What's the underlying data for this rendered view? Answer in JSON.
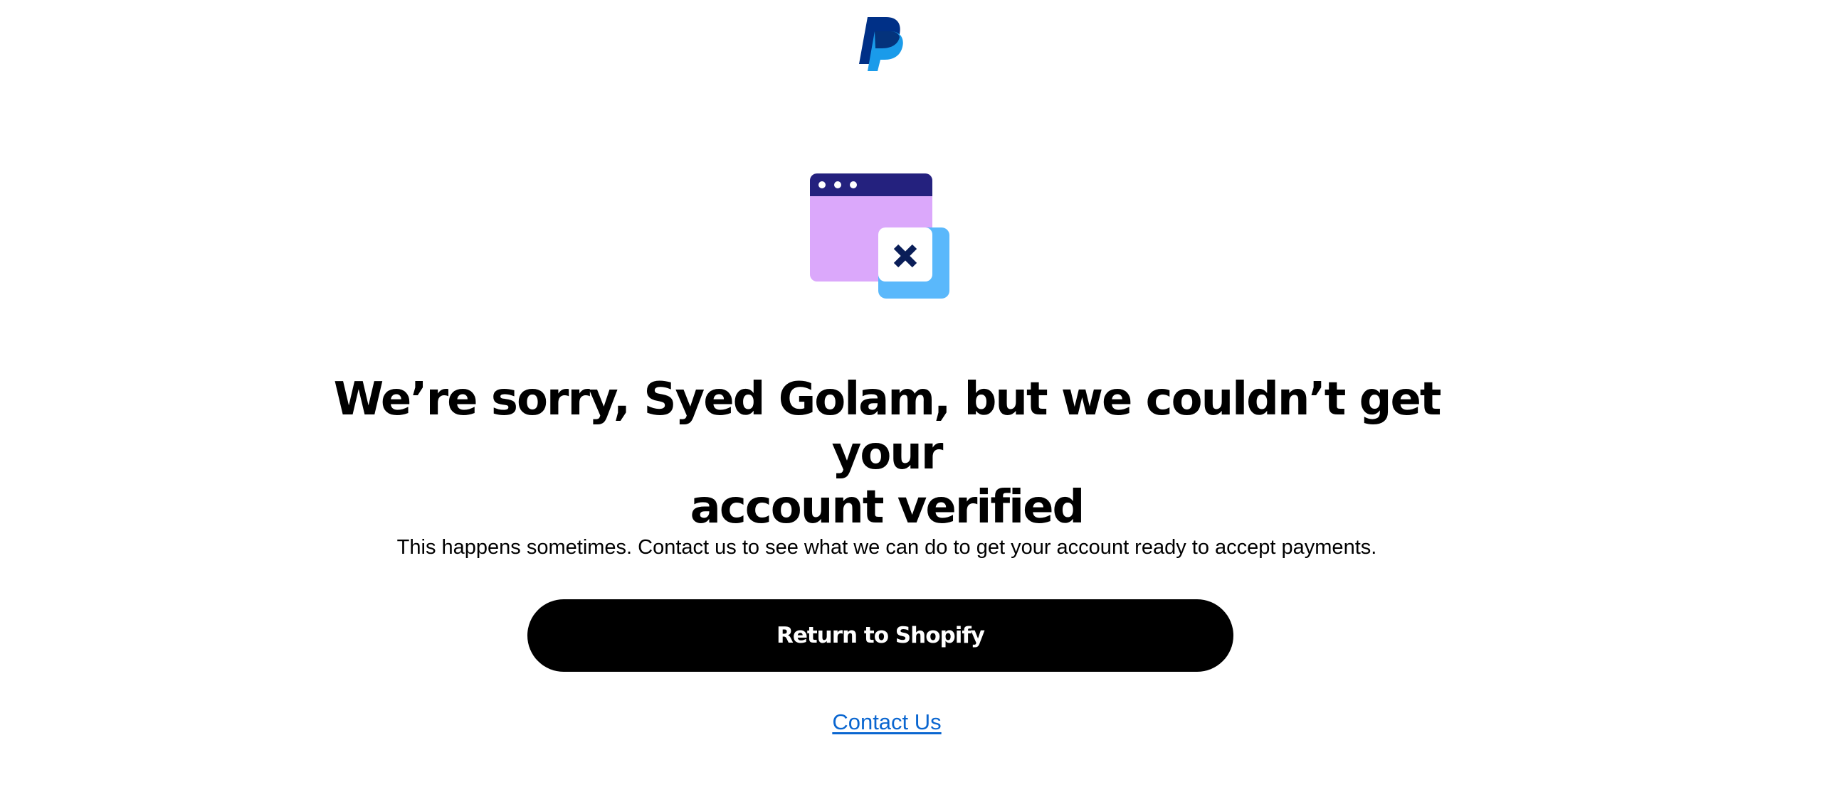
{
  "brand": {
    "logo_icon": "paypal-logo-icon",
    "colors": {
      "logo_dark": "#003087",
      "logo_light": "#1a9bea",
      "window_bar": "#24217e",
      "window_body": "#dba8fb",
      "error_badge": "#5ab8fb",
      "error_card": "#ffffff",
      "cross": "#0a1e58"
    }
  },
  "illustration": {
    "icon": "browser-window-error-icon"
  },
  "message": {
    "headline_line1": "We’re sorry, Syed Golam, but we couldn’t get your",
    "headline_line2": "account verified",
    "body": "This happens sometimes. Contact us to see what we can do to get your account ready to accept payments."
  },
  "actions": {
    "primary_label": "Return to Shopify",
    "secondary_label": "Contact Us",
    "primary_color": "#000000",
    "link_color": "#0a66d0"
  }
}
